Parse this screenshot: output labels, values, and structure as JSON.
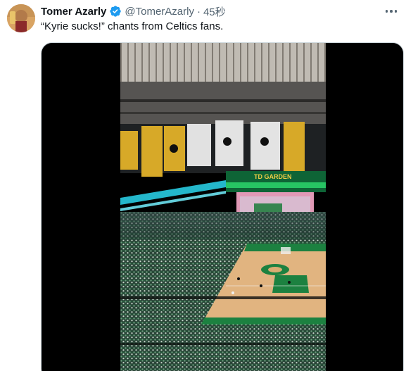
{
  "tweet": {
    "author_name": "Tomer Azarly",
    "handle": "@TomerAzarly",
    "separator": "·",
    "time": "45秒",
    "text": "“Kyrie sucks!” chants from Celtics fans.",
    "verified": true
  },
  "icons": {
    "verified": "verified-badge-icon",
    "more": "more-options-icon"
  },
  "colors": {
    "verified_blue": "#1d9bf0",
    "text_primary": "#0f1419",
    "text_secondary": "#536471",
    "court_green": "#1e8a44",
    "banner_gold": "#e5b42b"
  },
  "media": {
    "type": "video",
    "jumbotron_text": "TD GARDEN"
  }
}
